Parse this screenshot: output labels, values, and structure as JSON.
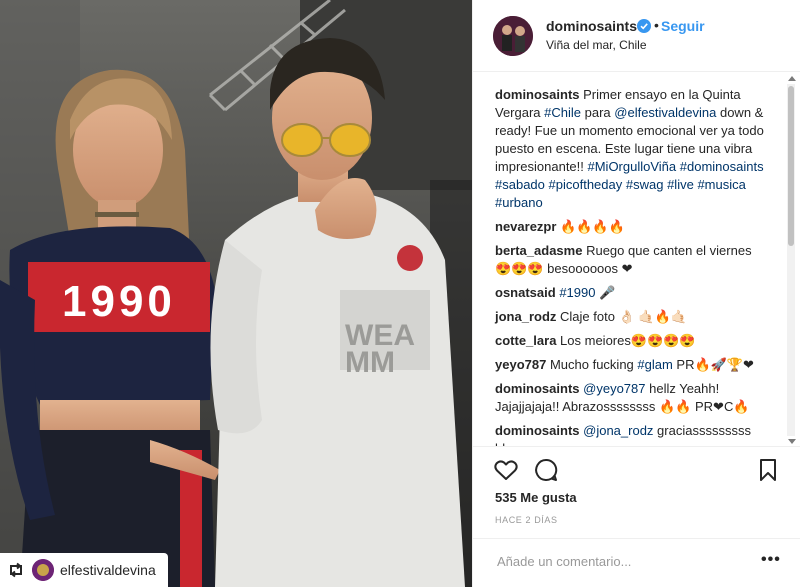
{
  "photo": {
    "shirt_text": "1990",
    "regram": {
      "icon": "regram-icon",
      "account": "elfestivaldevina"
    }
  },
  "header": {
    "username": "dominosaints",
    "verified_icon": "verified-badge-icon",
    "separator": "•",
    "follow_label": "Seguir",
    "location": "Viña del mar, Chile"
  },
  "comments": [
    {
      "user": "dominosaints",
      "parts": [
        {
          "k": "t",
          "v": "Primer ensayo en la Quinta Vergara "
        },
        {
          "k": "h",
          "v": "#Chile"
        },
        {
          "k": "t",
          "v": " para "
        },
        {
          "k": "m",
          "v": "@elfestivaldevina"
        },
        {
          "k": "t",
          "v": " down & ready! Fue un momento emocional ver ya todo puesto en escena. Este lugar tiene una vibra impresionante!! "
        },
        {
          "k": "h",
          "v": "#MiOrgulloViña"
        },
        {
          "k": "t",
          "v": " "
        },
        {
          "k": "h",
          "v": "#dominosaints"
        },
        {
          "k": "t",
          "v": " "
        },
        {
          "k": "h",
          "v": "#sabado"
        },
        {
          "k": "t",
          "v": " "
        },
        {
          "k": "h",
          "v": "#picoftheday"
        },
        {
          "k": "t",
          "v": " "
        },
        {
          "k": "h",
          "v": "#swag"
        },
        {
          "k": "t",
          "v": " "
        },
        {
          "k": "h",
          "v": "#live"
        },
        {
          "k": "t",
          "v": " "
        },
        {
          "k": "h",
          "v": "#musica"
        },
        {
          "k": "t",
          "v": " "
        },
        {
          "k": "h",
          "v": "#urbano"
        }
      ]
    },
    {
      "user": "nevarezpr",
      "parts": [
        {
          "k": "t",
          "v": "🔥🔥🔥🔥"
        }
      ]
    },
    {
      "user": "berta_adasme",
      "parts": [
        {
          "k": "t",
          "v": "Ruego que canten el viernes 😍😍😍 besoooooos ❤"
        }
      ]
    },
    {
      "user": "osnatsaid",
      "parts": [
        {
          "k": "h",
          "v": "#1990"
        },
        {
          "k": "t",
          "v": " 🎤"
        }
      ]
    },
    {
      "user": "jona_rodz",
      "parts": [
        {
          "k": "t",
          "v": "Claje foto 👌🏻 🤙🏻🔥🤙🏻"
        }
      ]
    },
    {
      "user": "cotte_lara",
      "parts": [
        {
          "k": "t",
          "v": "Los meiores😍😍😍😍"
        }
      ]
    },
    {
      "user": "yeyo787",
      "parts": [
        {
          "k": "t",
          "v": "Mucho fucking "
        },
        {
          "k": "h",
          "v": "#glam"
        },
        {
          "k": "t",
          "v": " PR🔥🚀🏆❤"
        }
      ]
    },
    {
      "user": "dominosaints",
      "parts": [
        {
          "k": "m",
          "v": "@yeyo787"
        },
        {
          "k": "t",
          "v": " hellz Yeahh! Jajajjajaja!! Abrazossssssss 🔥🔥 PR❤C🔥"
        }
      ]
    },
    {
      "user": "dominosaints",
      "parts": [
        {
          "k": "m",
          "v": "@jona_rodz"
        },
        {
          "k": "t",
          "v": " graciasssssssss blesss"
        }
      ]
    }
  ],
  "actions": {
    "like_icon": "heart-icon",
    "comment_icon": "comment-icon",
    "save_icon": "bookmark-icon",
    "likes": "535 Me gusta",
    "time_ago": "HACE 2 DÍAS"
  },
  "add_comment": {
    "placeholder": "Añade un comentario...",
    "more_label": "•••"
  },
  "colors": {
    "link": "#3897f0",
    "hashtag": "#003569",
    "text": "#262626",
    "muted": "#999999",
    "border": "#efefef"
  }
}
